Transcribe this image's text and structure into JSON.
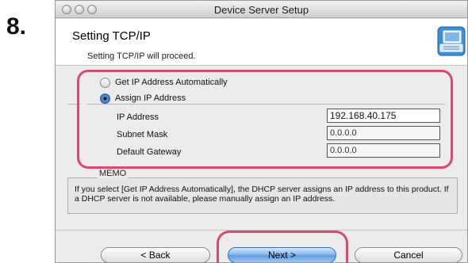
{
  "step": {
    "number": "8."
  },
  "window": {
    "title": "Device Server Setup"
  },
  "header": {
    "title": "Setting TCP/IP",
    "subtitle": "Setting TCP/IP will proceed."
  },
  "options": {
    "auto_label": "Get IP Address Automatically",
    "assign_label": "Assign IP Address",
    "selected": "assign"
  },
  "fields": {
    "ip_label": "IP Address",
    "ip_value": "192.168.40.175",
    "subnet_label": "Subnet Mask",
    "subnet_value": "0.0.0.0",
    "gateway_label": "Default Gateway",
    "gateway_value": "0.0.0.0"
  },
  "memo": {
    "label": "MEMO",
    "text": "If you select [Get IP Address Automatically], the DHCP server assigns an IP address to this product. If a DHCP server is not available, please manually assign an IP address."
  },
  "buttons": {
    "back": "< Back",
    "next": "Next >",
    "cancel": "Cancel"
  },
  "colors": {
    "highlight": "#d94a6e",
    "primary_button": "#5d9ae0"
  }
}
